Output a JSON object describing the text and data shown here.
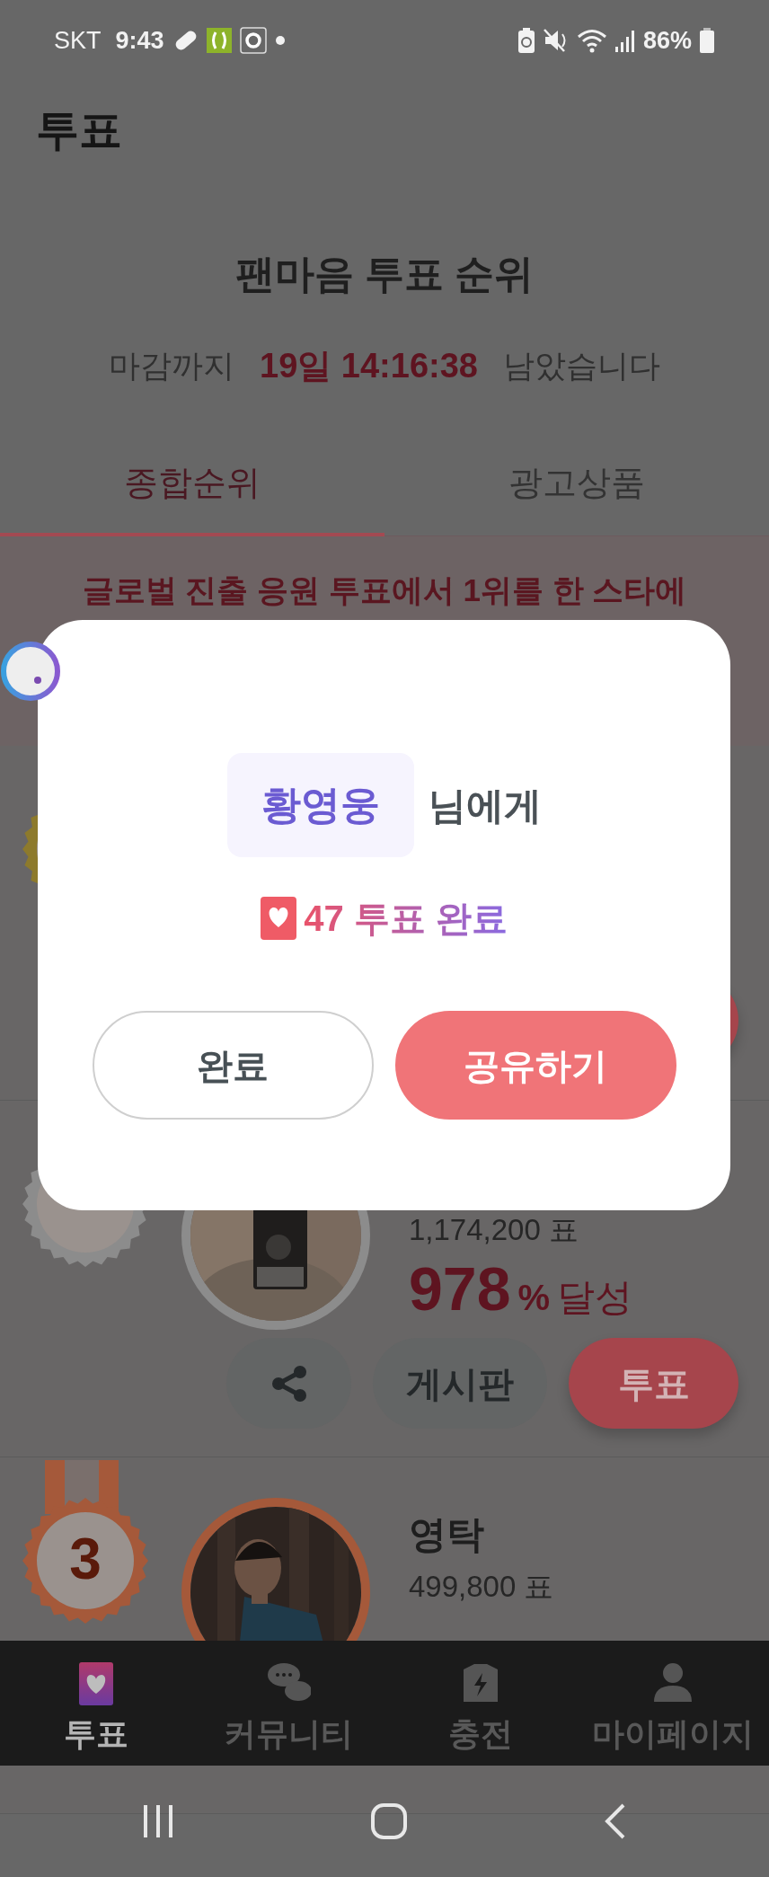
{
  "status_bar": {
    "carrier": "SKT",
    "time": "9:43",
    "battery": "86%"
  },
  "header": {
    "title": "투표"
  },
  "ranking": {
    "title": "팬마음 투표 순위",
    "deadline_prefix": "마감까지",
    "countdown": "19일 14:16:38",
    "deadline_suffix": "남았습니다"
  },
  "tabs": [
    {
      "label": "종합순위",
      "selected": true
    },
    {
      "label": "광고상품",
      "selected": false
    }
  ],
  "banner": "글로벌 진출 응원 투표에서 1위를 한 스타에",
  "entries": [
    {
      "color": "#8d7a2c",
      "buttons": [
        {
          "kind": "vote"
        }
      ]
    },
    {
      "color": "#8c8c8c",
      "votes": "1,174,200 표",
      "percent": "978",
      "percent_unit": "%",
      "percent_suffix": "달성",
      "buttons": [
        {
          "kind": "share"
        },
        {
          "kind": "board",
          "label": "게시판"
        },
        {
          "kind": "vote",
          "label": "투표"
        }
      ]
    },
    {
      "color": "#a5593a",
      "rank": "3",
      "name": "영탁",
      "votes": "499,800 표"
    }
  ],
  "modal": {
    "recipient": "황영웅",
    "recipient_suffix": "님에게",
    "result": "47 투표 완료",
    "buttons": [
      {
        "label": "완료",
        "kind": "outline"
      },
      {
        "label": "공유하기",
        "kind": "primary"
      }
    ]
  },
  "bottom_nav": [
    {
      "label": "투표",
      "kind": "vote",
      "selected": true
    },
    {
      "label": "커뮤니티",
      "kind": "community",
      "selected": false
    },
    {
      "label": "충전",
      "kind": "charge",
      "selected": false
    },
    {
      "label": "마이페이지",
      "kind": "mypage",
      "selected": false
    }
  ]
}
